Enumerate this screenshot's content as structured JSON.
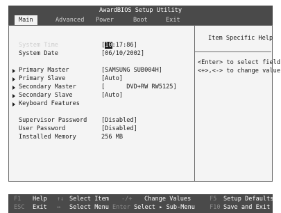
{
  "title": "AwardBIOS Setup Utility",
  "menu": [
    "Main",
    "Advanced",
    "Power",
    "Boot",
    "Exit"
  ],
  "help": {
    "title": "Item Specific Help",
    "line1": "<Enter> to select field;",
    "line2": "<+>,<-> to change value."
  },
  "fields": {
    "system_time": {
      "label": "System Time",
      "value_cursor": "10",
      "value_rest": ":17:86]",
      "bracket": "["
    },
    "system_date": {
      "label": "System Date",
      "value": "[06/10/2002]"
    },
    "primary_master": {
      "label": "Primary Master",
      "value": "[SAMSUNG SUB004H]"
    },
    "primary_slave": {
      "label": "Primary Slave",
      "value": "[Auto]"
    },
    "secondary_master": {
      "label": "Secondary Master",
      "value": "[      DVD+RW RW5125]"
    },
    "secondary_slave": {
      "label": "Secondary Slave",
      "value": "[Auto]"
    },
    "keyboard_features": {
      "label": "Keyboard Features"
    },
    "supervisor_password": {
      "label": "Supervisor Password",
      "value": "[Disabled]"
    },
    "user_password": {
      "label": "User Password",
      "value": "[Disabled]"
    },
    "installed_memory": {
      "label": "Installed Memory",
      "value": "256 MB"
    }
  },
  "status": {
    "f1_key": "F1",
    "f1_label": "Help",
    "updown_key": "↑↓",
    "updown_label": "Select Item",
    "plusminus_key": "-/+",
    "plusminus_label": "Change Values",
    "f5_key": "F5",
    "f5_label": "Setup Defaults",
    "esc_key": "ESC",
    "esc_label": "Exit",
    "leftright_key": "↔",
    "leftright_label": "Select Menu",
    "enter_key": "Enter",
    "enter_label": "Select ▸ Sub-Menu",
    "f10_key": "F10",
    "f10_label": "Save and Exit"
  }
}
